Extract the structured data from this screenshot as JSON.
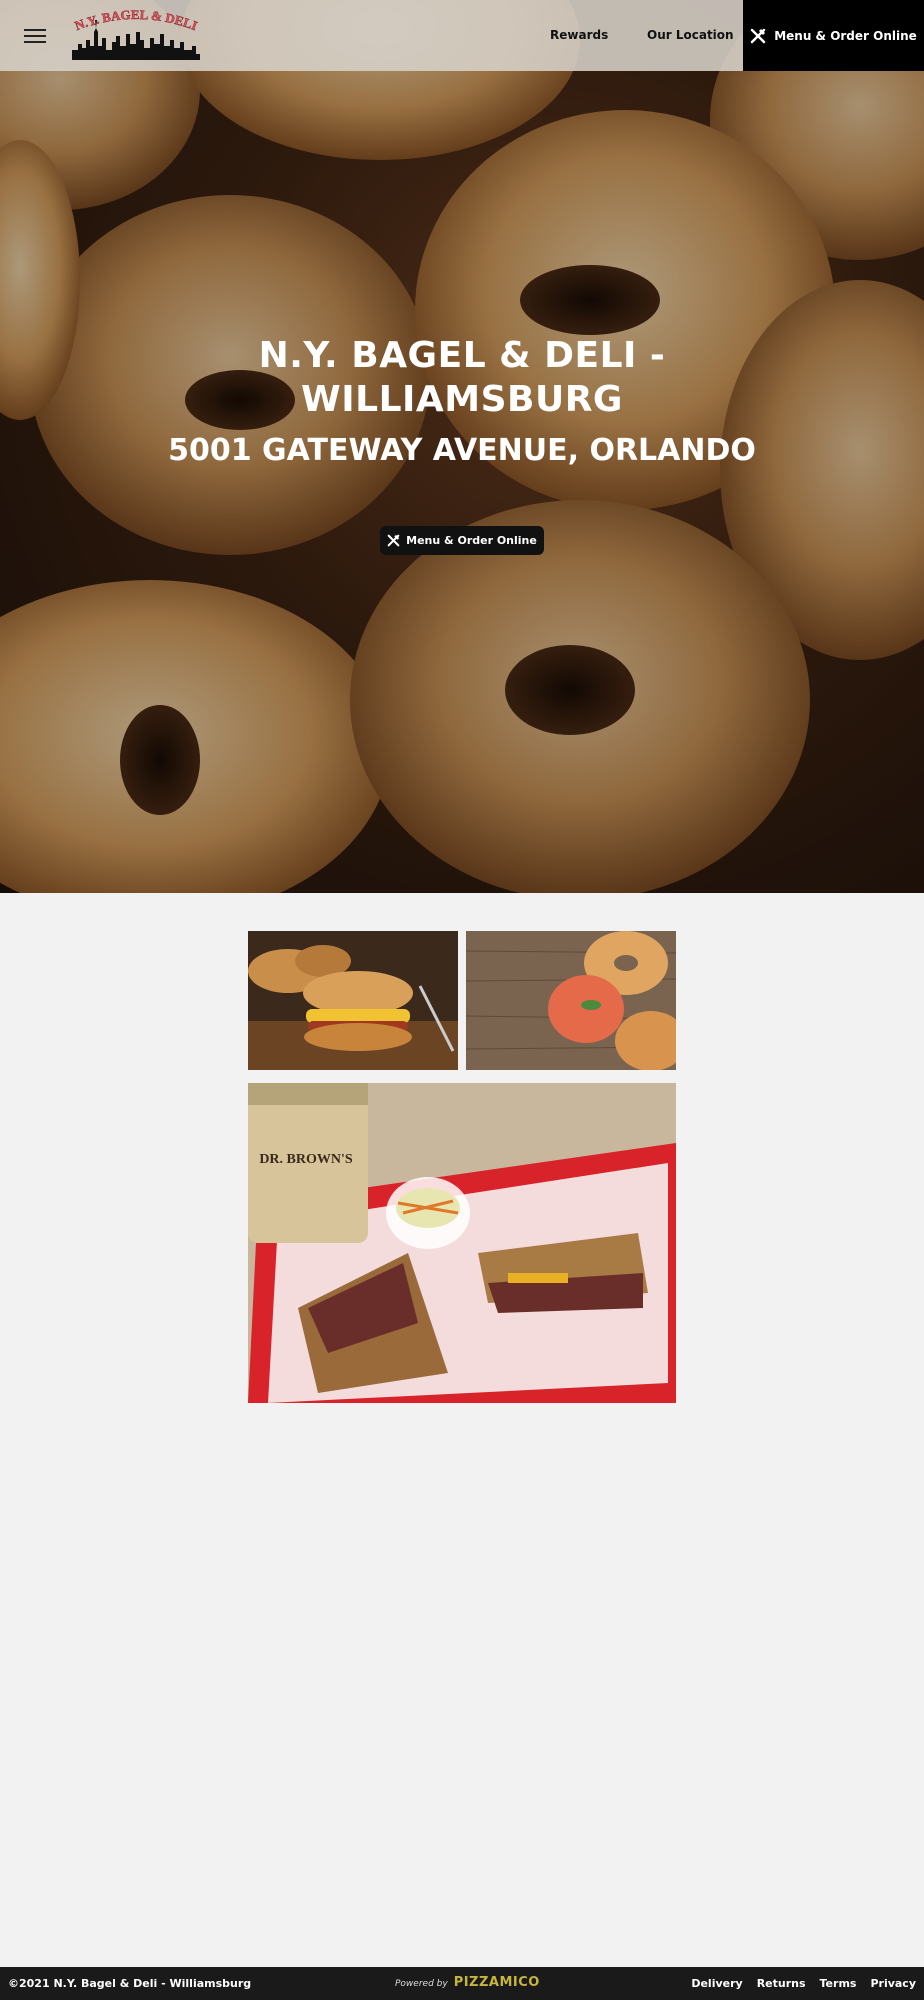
{
  "header": {
    "logo_text": "N.Y. BAGEL & DELI",
    "nav": {
      "rewards": "Rewards",
      "location": "Our Location"
    },
    "cta_label": "Menu & Order Online"
  },
  "hero": {
    "title": "N.Y. BAGEL & DELI - WILLIAMSBURG",
    "address": "5001 GATEWAY AVENUE, ORLANDO",
    "cta_label": "Menu & Order Online"
  },
  "gallery": {
    "can_text": "DR. BROWN'S"
  },
  "footer": {
    "copyright": "©2021 N.Y. Bagel & Deli - Williamsburg",
    "powered_label": "Powered by",
    "powered_brand": "PIZZAMICO",
    "links": [
      "Delivery",
      "Returns",
      "Terms",
      "Privacy"
    ]
  },
  "colors": {
    "header_bg": "#d7d2ca",
    "cta_bg": "#000000",
    "page_bg": "#f2f2f2",
    "footer_bg": "#1a1a1a",
    "brand_accent": "#c8b63a",
    "logo_red": "#e0505a"
  },
  "icons": {
    "menu": "hamburger-icon",
    "cta": "fork-knife-icon"
  }
}
